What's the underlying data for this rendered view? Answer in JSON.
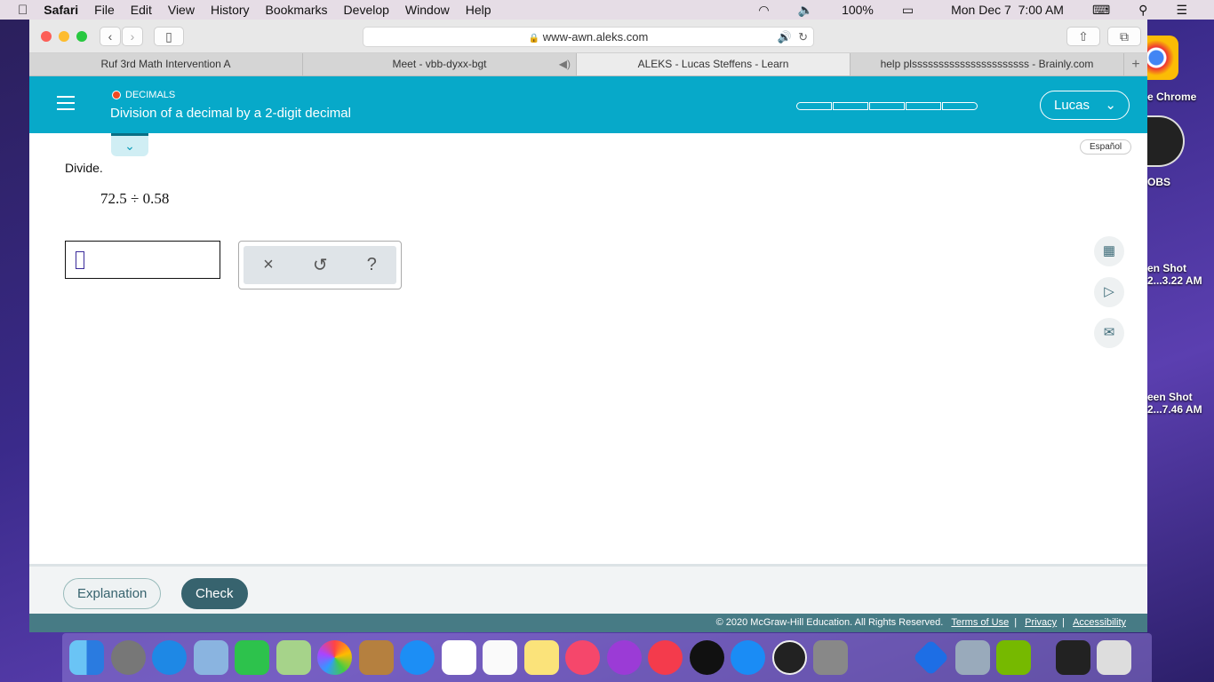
{
  "menubar": {
    "app": "Safari",
    "items": [
      "File",
      "Edit",
      "View",
      "History",
      "Bookmarks",
      "Develop",
      "Window",
      "Help"
    ],
    "battery": "100%",
    "datetime": "Mon Dec 7  7:00 AM"
  },
  "browser": {
    "url": "www-awn.aleks.com",
    "tabs": [
      {
        "label": "Ruf 3rd Math Intervention A"
      },
      {
        "label": "Meet - vbb-dyxx-bgt"
      },
      {
        "label": "ALEKS - Lucas Steffens - Learn"
      },
      {
        "label": "help plssssssssssssssssssssss - Brainly.com"
      }
    ],
    "new_tab": "+"
  },
  "header": {
    "topic": "DECIMALS",
    "title": "Division of a decimal by a 2-digit decimal",
    "progress_segments_filled": 0,
    "progress_segments_total": 5,
    "user": "Lucas"
  },
  "content": {
    "language": "Español",
    "prompt": "Divide.",
    "expression": "72.5 ÷ 0.58",
    "answer_value": "",
    "tools": {
      "clear": "×",
      "undo": "↺",
      "help": "?"
    }
  },
  "side_icons": [
    "calculator-disabled-icon",
    "video-icon",
    "mail-icon"
  ],
  "actions": {
    "explanation": "Explanation",
    "check": "Check"
  },
  "footer": {
    "copyright": "© 2020 McGraw-Hill Education. All Rights Reserved.",
    "links": [
      "Terms of Use",
      "Privacy",
      "Accessibility"
    ]
  },
  "desktop": {
    "items": [
      "e Chrome",
      "OBS",
      "en Shot\n2...3.22 AM",
      "een Shot\n2...7.46 AM"
    ]
  },
  "colors": {
    "header": "#07a9c9",
    "check": "#37636e",
    "footer": "#477b85",
    "topic_dot": "#f04a23"
  }
}
